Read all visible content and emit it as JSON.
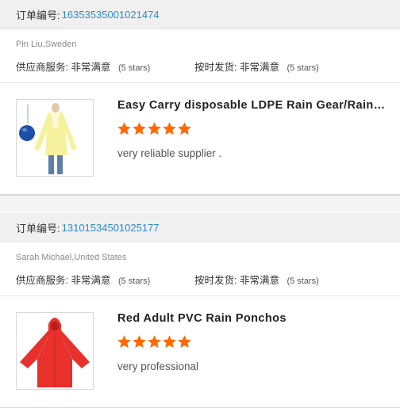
{
  "orders": [
    {
      "order_label": "订单编号:",
      "order_number": "16353535001021474",
      "buyer": "Pin Liu,Sweden",
      "supplier_service_label": "供应商服务:",
      "supplier_service_value": "非常满意",
      "supplier_service_stars": "(5 stars)",
      "on_time_label": "按时发货:",
      "on_time_value": "非常满意",
      "on_time_stars": "(5 stars)",
      "product_title": "Easy Carry disposable LDPE Rain Gear/Raincoat with Ball",
      "rating": 5,
      "review": "very reliable supplier ."
    },
    {
      "order_label": "订单编号:",
      "order_number": "13101534501025177",
      "buyer": "Sarah Michael,United States",
      "supplier_service_label": "供应商服务:",
      "supplier_service_value": "非常满意",
      "supplier_service_stars": "(5 stars)",
      "on_time_label": "按时发货:",
      "on_time_value": "非常满意",
      "on_time_stars": "(5 stars)",
      "product_title": "Red Adult PVC Rain Ponchos",
      "rating": 5,
      "review": "very professional"
    }
  ],
  "colors": {
    "star": "#ff6a00",
    "link": "#2a8bd0",
    "header_bg": "#f0f0f0"
  },
  "icons": {
    "rating": "star-icon"
  }
}
